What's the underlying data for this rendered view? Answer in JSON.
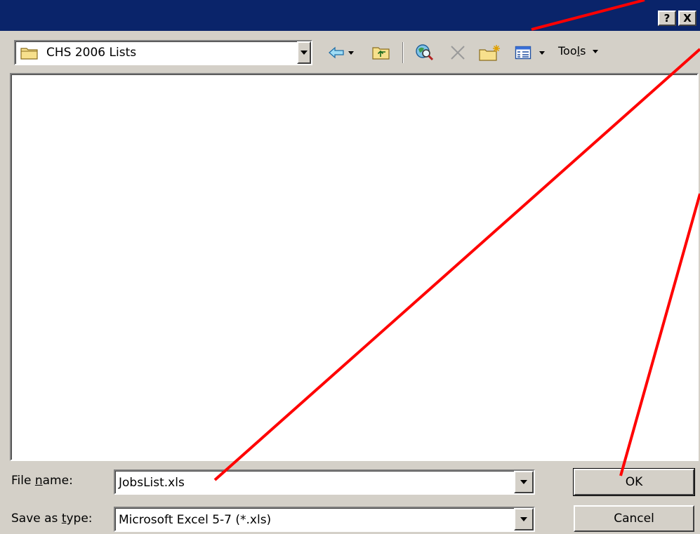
{
  "title_bar": {
    "help_label": "?",
    "close_label": "X"
  },
  "toolbar": {
    "look_in_value": "CHS 2006 Lists",
    "back_icon": "back-arrow-icon",
    "up_icon": "up-folder-icon",
    "search_web_icon": "search-web-icon",
    "delete_icon": "delete-icon",
    "new_folder_icon": "new-folder-icon",
    "views_icon": "views-icon",
    "tools_prefix": "Too",
    "tools_accel": "l",
    "tools_suffix": "s"
  },
  "form": {
    "filename_label_prefix": "File ",
    "filename_label_accel": "n",
    "filename_label_suffix": "ame:",
    "filename_value": "JobsList.xls",
    "savetype_label_prefix": "Save as ",
    "savetype_label_accel": "t",
    "savetype_label_suffix": "ype:",
    "savetype_value": "Microsoft Excel 5-7 (*.xls)"
  },
  "buttons": {
    "ok_label": "OK",
    "cancel_label": "Cancel"
  },
  "colors": {
    "title_bar": "#0a246a",
    "dialog_face": "#d4d0c8",
    "annotation": "#ff0000"
  }
}
